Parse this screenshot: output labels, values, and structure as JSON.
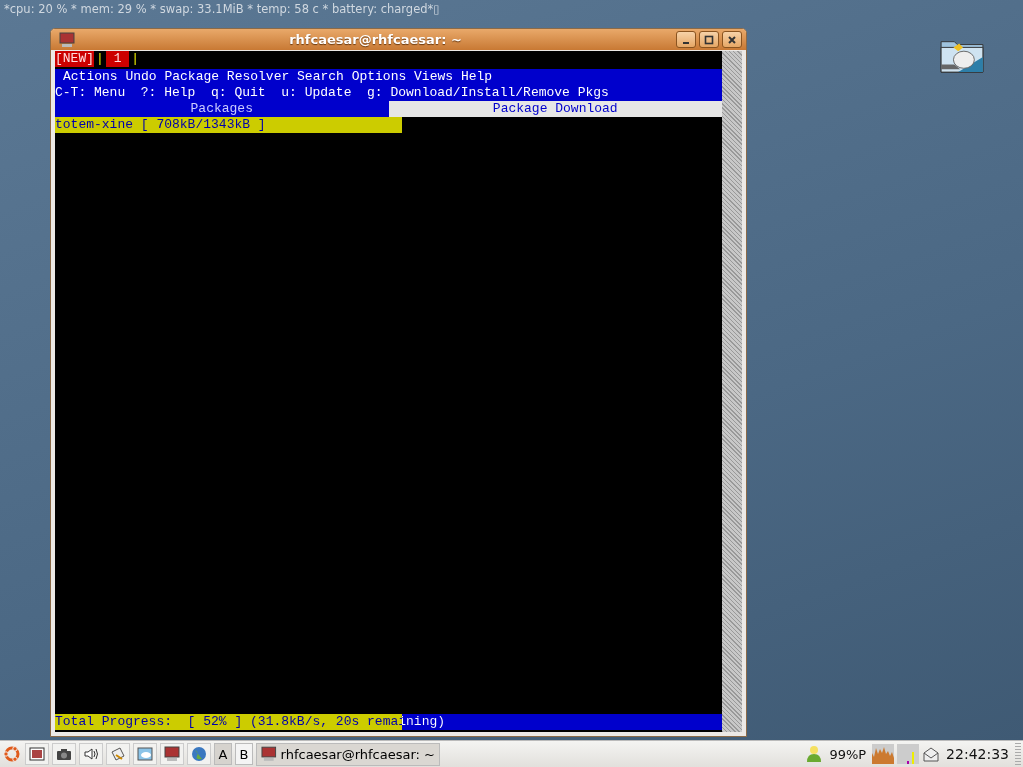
{
  "status_line": "*cpu: 20 % * mem: 29 % * swap: 33.1MiB * temp: 58  c * battery: charged*▯",
  "window": {
    "title": "rhfcaesar@rhfcaesar: ~"
  },
  "screen_tabs": [
    {
      "label": "[NEW]",
      "separator": "|"
    },
    {
      "label": " 1 ",
      "separator": "|"
    }
  ],
  "menu": [
    "Actions",
    "Undo",
    "Package",
    "Resolver",
    "Search",
    "Options",
    "Views",
    "Help"
  ],
  "hint_line": "C-T: Menu  ?: Help  q: Quit  u: Update  g: Download/Install/Remove Pkgs",
  "view_tabs": [
    {
      "label": "Packages",
      "selected": false
    },
    {
      "label": "Package Download",
      "selected": true
    }
  ],
  "downloads": [
    {
      "text": "totem-xine [ 708kB/1343kB ]",
      "level": 0.52
    }
  ],
  "total_progress": {
    "text": "Total Progress:  [ 52% ] (31.8kB/s, 20s remaining)",
    "level": 0.52
  },
  "taskbar": {
    "workspaces": [
      {
        "label": "A",
        "selected": true
      },
      {
        "label": "B",
        "selected": false
      }
    ],
    "task": "rhfcaesar@rhfcaesar: ~",
    "battery": "99%P",
    "clock": "22:42:33"
  }
}
